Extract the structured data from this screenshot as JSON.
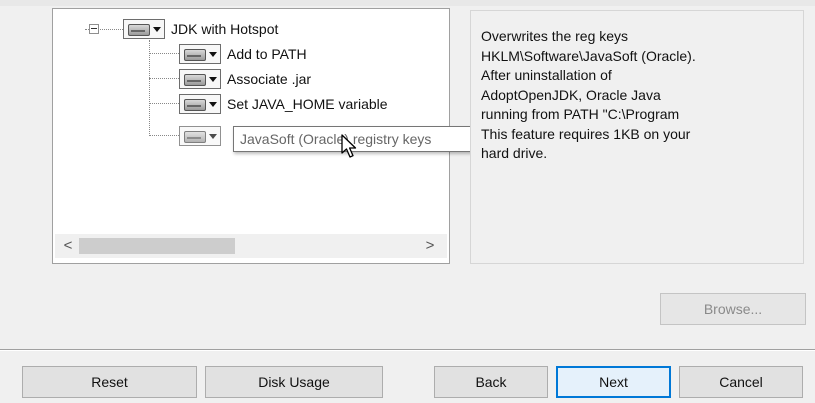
{
  "tree": {
    "root": {
      "label": "JDK with Hotspot",
      "icon": "hard-drive-icon"
    },
    "children": [
      {
        "label": "Add to PATH",
        "icon": "hard-drive-icon"
      },
      {
        "label": "Associate .jar",
        "icon": "hard-drive-icon"
      },
      {
        "label": "Set JAVA_HOME variable",
        "icon": "hard-drive-icon"
      },
      {
        "label": "JavaSoft (Oracle) registry keys",
        "icon": "hard-drive-icon",
        "state": "unavailable"
      }
    ],
    "tooltip": "JavaSoft (Oracle) registry keys",
    "scroll_left": "<",
    "scroll_right": ">"
  },
  "description": {
    "lines": [
      "Overwrites the reg keys",
      "HKLM\\Software\\JavaSoft (Oracle).",
      "After uninstallation of",
      "AdoptOpenJDK, Oracle Java",
      "running from PATH \"C:\\Program",
      "This feature requires 1KB on your",
      "hard drive."
    ]
  },
  "buttons": {
    "browse": "Browse...",
    "reset": "Reset",
    "disk_usage": "Disk Usage",
    "back": "Back",
    "next": "Next",
    "cancel": "Cancel"
  },
  "colors": {
    "focus_border": "#0078d7",
    "window_bg": "#f0f0f0"
  }
}
